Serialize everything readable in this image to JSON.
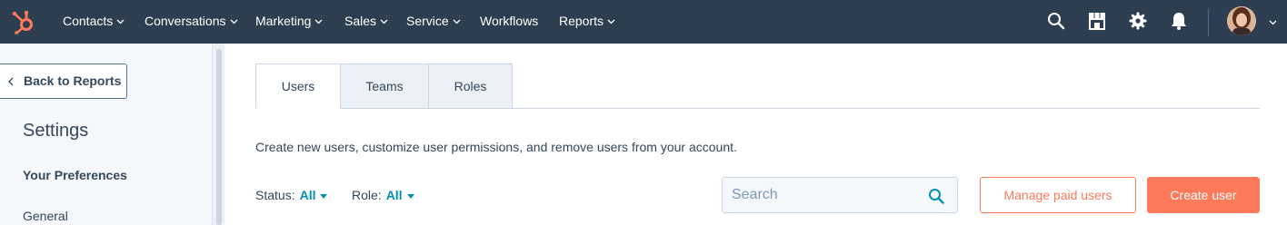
{
  "colors": {
    "topnav_bg": "#2d3e50",
    "brand_orange": "#ff7a59",
    "link_teal": "#0091ae",
    "text": "#33475b",
    "sidebar_bg": "#f5f8fa"
  },
  "topnav": {
    "logo_icon": "hubspot-sprocket-icon",
    "items": [
      {
        "label": "Contacts",
        "has_dropdown": true
      },
      {
        "label": "Conversations",
        "has_dropdown": true
      },
      {
        "label": "Marketing",
        "has_dropdown": true
      },
      {
        "label": "Sales",
        "has_dropdown": true
      },
      {
        "label": "Service",
        "has_dropdown": true
      },
      {
        "label": "Workflows",
        "has_dropdown": false
      },
      {
        "label": "Reports",
        "has_dropdown": true
      }
    ],
    "utility_icons": [
      "search-icon",
      "marketplace-icon",
      "settings-gear-icon",
      "notifications-bell-icon"
    ],
    "account_icon": "user-avatar"
  },
  "sidebar": {
    "back_label": "Back to Reports",
    "title": "Settings",
    "section_heading": "Your Preferences",
    "items": [
      {
        "label": "General"
      }
    ]
  },
  "main": {
    "tabs": [
      {
        "label": "Users",
        "active": true
      },
      {
        "label": "Teams",
        "active": false
      },
      {
        "label": "Roles",
        "active": false
      }
    ],
    "description": "Create new users, customize user permissions, and remove users from your account.",
    "filters": {
      "status": {
        "label": "Status:",
        "value": "All"
      },
      "role": {
        "label": "Role:",
        "value": "All"
      }
    },
    "search": {
      "placeholder": "Search",
      "value": ""
    },
    "manage_paid_users_label": "Manage paid users",
    "create_user_label": "Create user"
  }
}
